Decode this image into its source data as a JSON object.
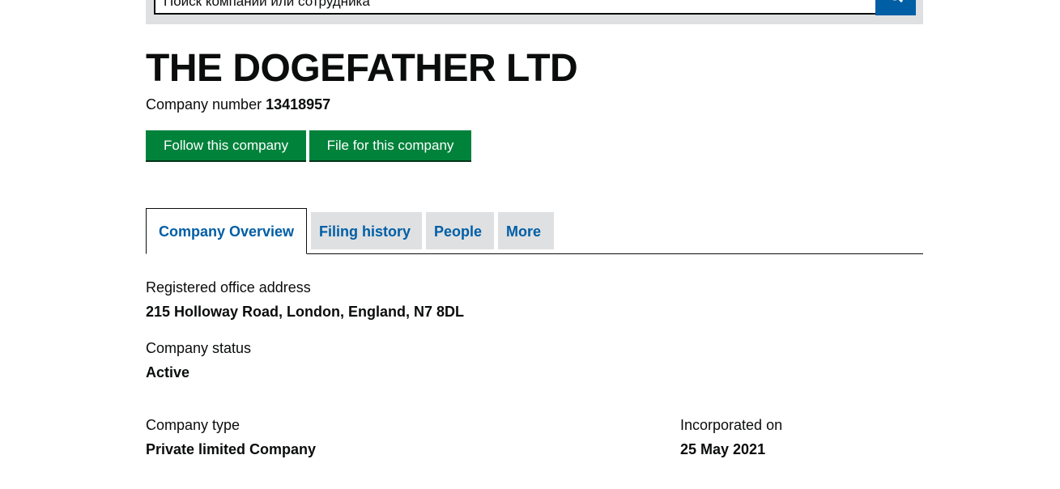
{
  "search": {
    "placeholder": "Поиск компании или сотрудника",
    "button_icon": "search-icon",
    "accent": "#005ea5"
  },
  "company": {
    "name": "THE DOGEFATHER LTD",
    "number_label": "Company number",
    "number": "13418957"
  },
  "actions": {
    "follow_label": "Follow this company",
    "file_label": "File for this company",
    "button_color": "#00823b"
  },
  "tabs": [
    {
      "label": "Company Overview",
      "active": true
    },
    {
      "label": "Filing history",
      "active": false
    },
    {
      "label": "People",
      "active": false
    },
    {
      "label": "More",
      "active": false
    }
  ],
  "overview": {
    "registered_office_label": "Registered office address",
    "registered_office_value": "215 Holloway Road, London, England, N7 8DL",
    "status_label": "Company status",
    "status_value": "Active",
    "type_label": "Company type",
    "type_value": "Private limited Company",
    "incorporated_label": "Incorporated on",
    "incorporated_value": "25 May 2021"
  }
}
